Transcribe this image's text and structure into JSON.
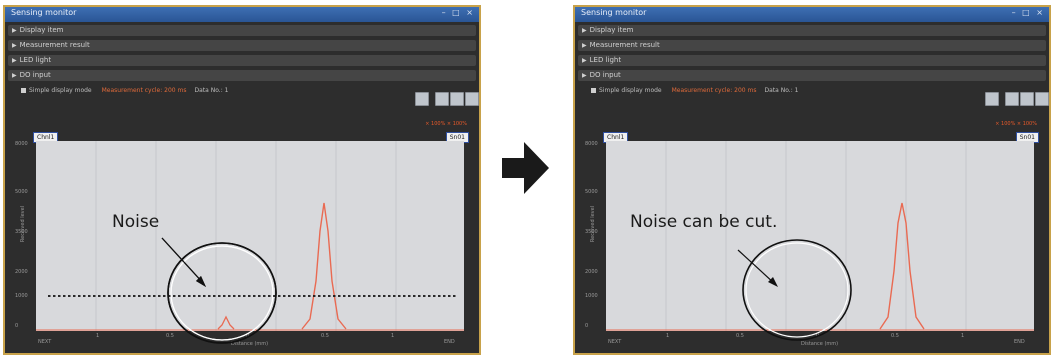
{
  "window_title": "Sensing monitor",
  "sections": [
    "Display item",
    "Measurement result",
    "LED light",
    "DO input"
  ],
  "options": {
    "display_mode": "Simple display mode",
    "measurement_cycle": "Measurement cycle: 200 ms",
    "data_no": "Data No.: 1"
  },
  "zoom_text": "× 100% × 100%",
  "channels": {
    "left": "Chnl1",
    "right": "Sn01"
  },
  "y_ticks": [
    "8000",
    "5000",
    "3500",
    "2000",
    "1000",
    "0"
  ],
  "y_label": "Received level",
  "x_ticks": [
    "NEXT",
    "1",
    "0.5",
    "0",
    "0.5",
    "1",
    "END"
  ],
  "x_label": "Distance (mm)",
  "annotation_left": "Noise",
  "annotation_right": "Noise can be cut.",
  "colors": {
    "accent_border": "#c8a24a",
    "signal": "#e96a52",
    "plot_bg": "#d8d9dc"
  },
  "window_buttons": "– □ ×"
}
